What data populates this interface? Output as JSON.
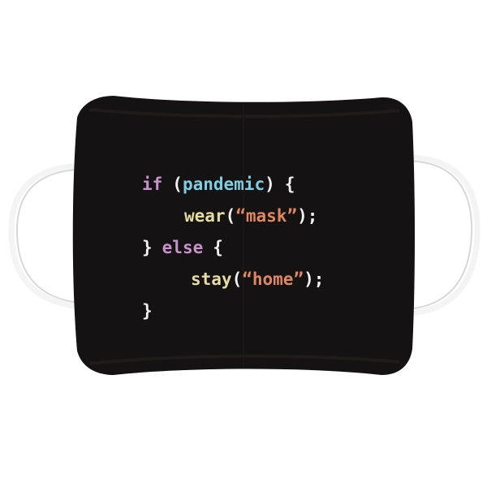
{
  "code_lines": [
    {
      "tokens": [
        {
          "text": "if",
          "role": "keyword"
        },
        {
          "text": " ",
          "role": "space"
        },
        {
          "text": "(",
          "role": "punctuation"
        },
        {
          "text": "pandemic",
          "role": "variable"
        },
        {
          "text": ")",
          "role": "punctuation"
        },
        {
          "text": " ",
          "role": "space"
        },
        {
          "text": "{",
          "role": "punctuation"
        }
      ]
    },
    {
      "tokens": [
        {
          "text": "wear",
          "role": "function"
        },
        {
          "text": "(",
          "role": "punctuation"
        },
        {
          "text": "“mask”",
          "role": "string"
        },
        {
          "text": ");",
          "role": "punctuation"
        }
      ]
    },
    {
      "tokens": [
        {
          "text": "}",
          "role": "punctuation"
        },
        {
          "text": " ",
          "role": "space"
        },
        {
          "text": "else",
          "role": "keyword"
        },
        {
          "text": " ",
          "role": "space"
        },
        {
          "text": "{",
          "role": "punctuation"
        }
      ]
    },
    {
      "tokens": [
        {
          "text": "stay",
          "role": "function"
        },
        {
          "text": "(",
          "role": "punctuation"
        },
        {
          "text": "“home”",
          "role": "string"
        },
        {
          "text": ");",
          "role": "punctuation"
        }
      ]
    },
    {
      "tokens": [
        {
          "text": "}",
          "role": "punctuation"
        }
      ]
    }
  ],
  "colors": {
    "mask_fabric": "#141212",
    "ear_loop": "#f4f4f4",
    "keyword": "#c792c9",
    "variable": "#7ecde0",
    "function": "#e4dca0",
    "string": "#e0875d",
    "punctuation": "#f2f2f2"
  }
}
